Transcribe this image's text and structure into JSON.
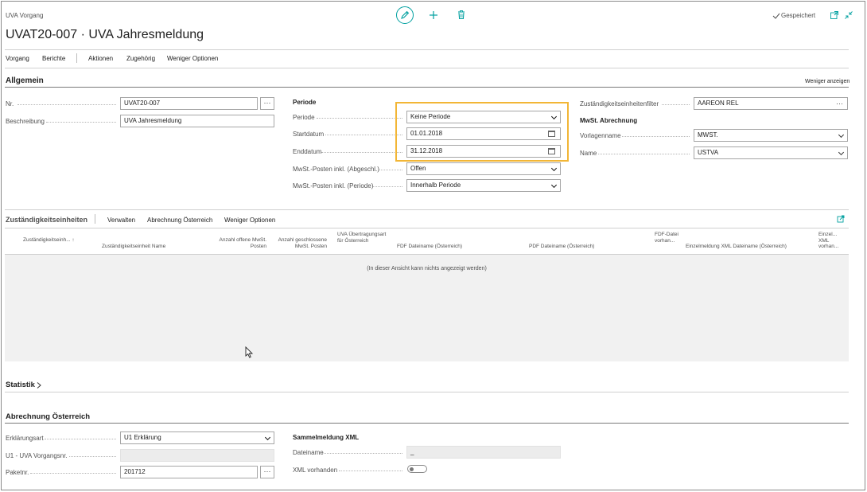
{
  "header": {
    "entity": "UVA Vorgang",
    "title": "UVAT20-007 · UVA Jahresmeldung",
    "saved_status": "Gespeichert"
  },
  "action_bar": {
    "items": [
      "Vorgang",
      "Berichte",
      "Aktionen",
      "Zugehörig",
      "Weniger Optionen"
    ]
  },
  "general": {
    "title": "Allgemein",
    "toggle": "Weniger anzeigen",
    "nr_label": "Nr.",
    "nr_value": "UVAT20-007",
    "beschreibung_label": "Beschreibung",
    "beschreibung_value": "UVA Jahresmeldung",
    "periode_group": "Periode",
    "periode_label": "Periode",
    "periode_value": "Keine Periode",
    "startdatum_label": "Startdatum",
    "startdatum_value": "01.01.2018",
    "enddatum_label": "Enddatum",
    "enddatum_value": "31.12.2018",
    "abgeschl_label": "MwSt.-Posten inkl. (Abgeschl.)",
    "abgeschl_value": "Offen",
    "periode_incl_label": "MwSt.-Posten inkl. (Periode)",
    "periode_incl_value": "Innerhalb Periode",
    "zust_filter_label": "Zuständigkeitseinheitenfilter",
    "zust_filter_value": "AAREON REL",
    "mwst_group": "MwSt. Abrechnung",
    "vorlagenname_label": "Vorlagenname",
    "vorlagenname_value": "MWST.",
    "name_label": "Name",
    "name_value": "USTVA"
  },
  "units": {
    "title": "Zuständigkeitseinheiten",
    "actions": [
      "Verwalten",
      "Abrechnung Österreich",
      "Weniger Optionen"
    ],
    "columns": [
      "Zuständigkeitseinh... ↑",
      "Zuständigkeitseinheit Name",
      "Anzahl offene MwSt. Posten",
      "Anzahl geschlossene MwSt. Posten",
      "UVA Übertragungsart für Österreich",
      "FDF Dateiname (Österreich)",
      "PDF Dateiname (Österreich)",
      "FDF-Datei vorhan...",
      "Einzelmeldung XML Dateiname (Österreich)",
      "Einzel... XML vorhan..."
    ],
    "empty_message": "(In dieser Ansicht kann nichts angezeigt werden)"
  },
  "statistik": {
    "title": "Statistik"
  },
  "austria": {
    "title": "Abrechnung Österreich",
    "erklaerungsart_label": "Erklärungsart",
    "erklaerungsart_value": "U1 Erklärung",
    "vorgangsnr_label": "U1 - UVA Vorgangsnr.",
    "vorgangsnr_value": "",
    "paketnr_label": "Paketnr.",
    "paketnr_value": "201712",
    "sammel_group": "Sammelmeldung XML",
    "dateiname_label": "Dateiname",
    "dateiname_value": "_",
    "xml_label": "XML vorhanden"
  },
  "colors": {
    "accent": "#00a0a0",
    "highlight": "#f2b636"
  },
  "icons": [
    "edit-icon",
    "add-icon",
    "delete-icon",
    "checkmark-icon",
    "open-new-window-icon",
    "collapse-icon",
    "expand-icon",
    "chevron-right-icon",
    "mouse-cursor-icon"
  ]
}
